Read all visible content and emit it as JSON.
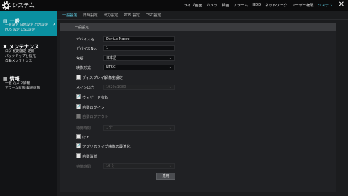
{
  "app": {
    "title": "システム"
  },
  "topnav": [
    "ライブ画面",
    "カメラ",
    "録画",
    "アラーム",
    "HDD",
    "ネットワーク",
    "ユーザー権限",
    "システム"
  ],
  "sidebar": {
    "general": {
      "title": "一般",
      "subs": [
        "一般設定 日時設定 出力設定",
        "POS 設定 OSD設定"
      ]
    },
    "maintenance": {
      "title": "メンテナンス",
      "subs": [
        "ログ 初期設定 更新",
        "バックアップと復元",
        "自動メンテナンス"
      ]
    },
    "info": {
      "title": "情報",
      "subs": [
        "一般 カメラ情報",
        "アラーム状態 録画状態"
      ]
    }
  },
  "tabs": [
    "一般設定",
    "日時設定",
    "出力設定",
    "POS 設定",
    "OSD設定"
  ],
  "panel": {
    "header": "一般設定"
  },
  "form": {
    "device_name_label": "デバイス名",
    "device_name_value": "Device Name",
    "device_no_label": "デバイスNo.",
    "device_no_value": "1",
    "language_label": "言語",
    "language_value": "日本語",
    "video_format_label": "映像形式",
    "video_format_value": "NTSC",
    "display_resolution_label": "ディスプレイ解像度設定",
    "main_output_label": "メイン出力",
    "main_output_value": "1920x1080",
    "wizard_label": "ウィザード有効",
    "auto_login_label": "自動ログイン",
    "auto_logout_label": "自動ログアウト",
    "wait_time_label_1": "待機時間",
    "wait_time_value_1": "1 分",
    "beep_label": "ほ t",
    "live_optimize_label": "アプリのライブ映像の最適化",
    "auto_hide_label": "自動消隠",
    "wait_time_label_2": "待機時間",
    "wait_time_value_2": "10 分",
    "apply_label": "適用"
  },
  "colors": {
    "accent": "#0a90a0",
    "active_text": "#5fd0e6"
  },
  "icons": {
    "logo": "gear-icon",
    "close": "close-icon",
    "maintenance": "tools-icon",
    "info": "info-icon"
  }
}
